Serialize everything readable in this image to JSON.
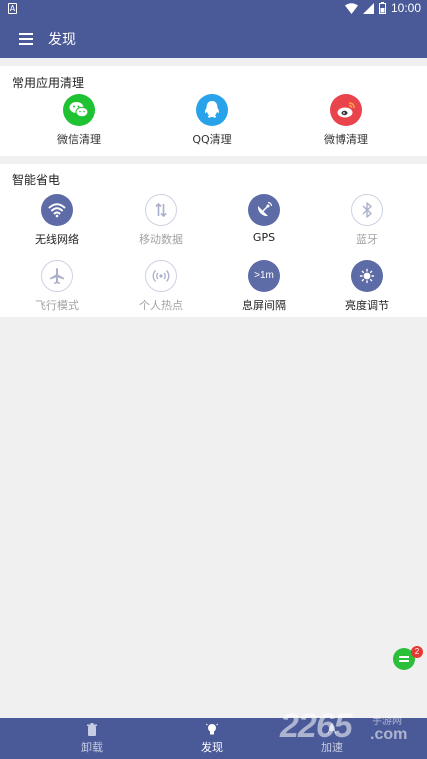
{
  "status_bar": {
    "time": "10:00",
    "left_icon": "A"
  },
  "app_bar": {
    "title": "发现"
  },
  "common_apps": {
    "title": "常用应用清理",
    "items": [
      {
        "label": "微信清理",
        "icon": "wechat-icon",
        "color": "#1ec233"
      },
      {
        "label": "QQ清理",
        "icon": "qq-icon",
        "color": "#28a3ea"
      },
      {
        "label": "微博清理",
        "icon": "weibo-icon",
        "color": "#e9434b"
      }
    ]
  },
  "power_saving": {
    "title": "智能省电",
    "items": [
      {
        "label": "无线网络",
        "icon": "wifi-icon",
        "state": "on"
      },
      {
        "label": "移动数据",
        "icon": "mobile-data-icon",
        "state": "off"
      },
      {
        "label": "GPS",
        "icon": "gps-icon",
        "state": "on"
      },
      {
        "label": "蓝牙",
        "icon": "bluetooth-icon",
        "state": "off"
      },
      {
        "label": "飞行模式",
        "icon": "airplane-icon",
        "state": "off"
      },
      {
        "label": "个人热点",
        "icon": "hotspot-icon",
        "state": "off"
      },
      {
        "label": "息屏间隔",
        "icon": "screen-timeout-icon",
        "state": "on",
        "icon_text": ">1m"
      },
      {
        "label": "亮度调节",
        "icon": "brightness-icon",
        "state": "on"
      }
    ]
  },
  "float_button": {
    "badge": "2"
  },
  "bottom_nav": {
    "items": [
      {
        "label": "卸载",
        "icon": "trash-icon",
        "active": false
      },
      {
        "label": "发现",
        "icon": "lightbulb-icon",
        "active": true
      },
      {
        "label": "加速",
        "icon": "rocket-icon",
        "active": false
      }
    ]
  },
  "watermark": {
    "text": "2265",
    "sub": "手游网",
    "com": ".com"
  },
  "colors": {
    "primary": "#4a5998",
    "icon_on": "#5d6ba7"
  }
}
